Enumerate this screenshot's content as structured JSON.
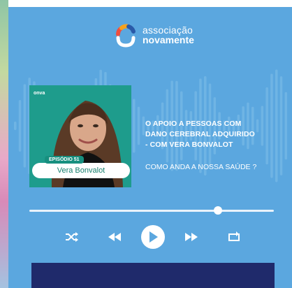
{
  "colors": {
    "background": "#5ba7df",
    "cover": "#1e9c8c",
    "accent_dark": "#1f2a6b",
    "name_text": "#17806f"
  },
  "logo": {
    "line1": "associação",
    "line2": "novamente"
  },
  "episode": {
    "brand": "onva",
    "badge": "EPISÓDIO 51",
    "guest": "Vera Bonvalot",
    "title_lines": [
      "O APOIO A PESSOAS COM",
      "DANO CEREBRAL ADQUIRIDO",
      "- COM VERA BONVALOT"
    ],
    "series": "COMO ANDA A NOSSA SAÚDE ?"
  },
  "player": {
    "progress": 0.77,
    "controls": [
      "shuffle-icon",
      "previous-icon",
      "play-icon",
      "next-icon",
      "repeat-icon"
    ]
  }
}
